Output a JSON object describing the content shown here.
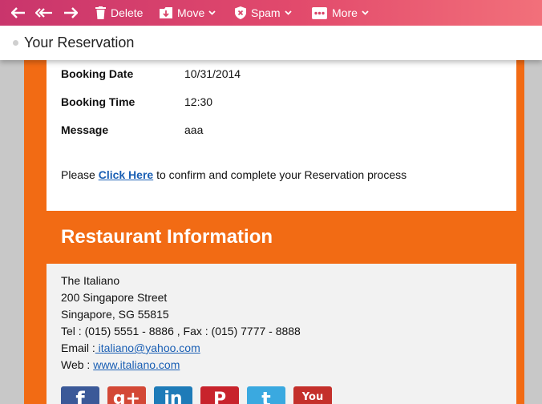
{
  "toolbar": {
    "delete_label": "Delete",
    "move_label": "Move",
    "spam_label": "Spam",
    "more_label": "More"
  },
  "subject": "Your Reservation",
  "booking": [
    {
      "key": "Booking Date",
      "value": "10/31/2014"
    },
    {
      "key": "Booking Time",
      "value": "12:30"
    },
    {
      "key": "Message",
      "value": "aaa"
    }
  ],
  "confirm": {
    "prefix": "Please ",
    "link": "Click Here",
    "suffix": " to confirm and complete your Reservation process"
  },
  "restaurant": {
    "heading": "Restaurant Information",
    "name": "The Italiano",
    "street": "200 Singapore Street",
    "city": "Singapore, SG 55815",
    "phone": "Tel : (015) 5551 - 8886 , Fax : (015) 7777 - 8888",
    "email_label": "Email :",
    "email": " italiano@yahoo.com",
    "web_label": "Web : ",
    "web": "www.italiano.com"
  },
  "social": [
    {
      "name": "facebook-icon",
      "glyph": "f",
      "color": "#3b5998"
    },
    {
      "name": "google-plus-icon",
      "glyph": "g+",
      "color": "#d34836"
    },
    {
      "name": "linkedin-icon",
      "glyph": "in",
      "color": "#1e7bb8"
    },
    {
      "name": "pinterest-icon",
      "glyph": "P",
      "color": "#c8232c"
    },
    {
      "name": "twitter-icon",
      "glyph": "t",
      "color": "#3aa9e0"
    },
    {
      "name": "youtube-icon",
      "glyph": "You",
      "color": "#c4302b"
    }
  ],
  "colors": {
    "accent": "#f26b14",
    "toolbar": "#e24a6c",
    "link": "#1a5fb4"
  }
}
